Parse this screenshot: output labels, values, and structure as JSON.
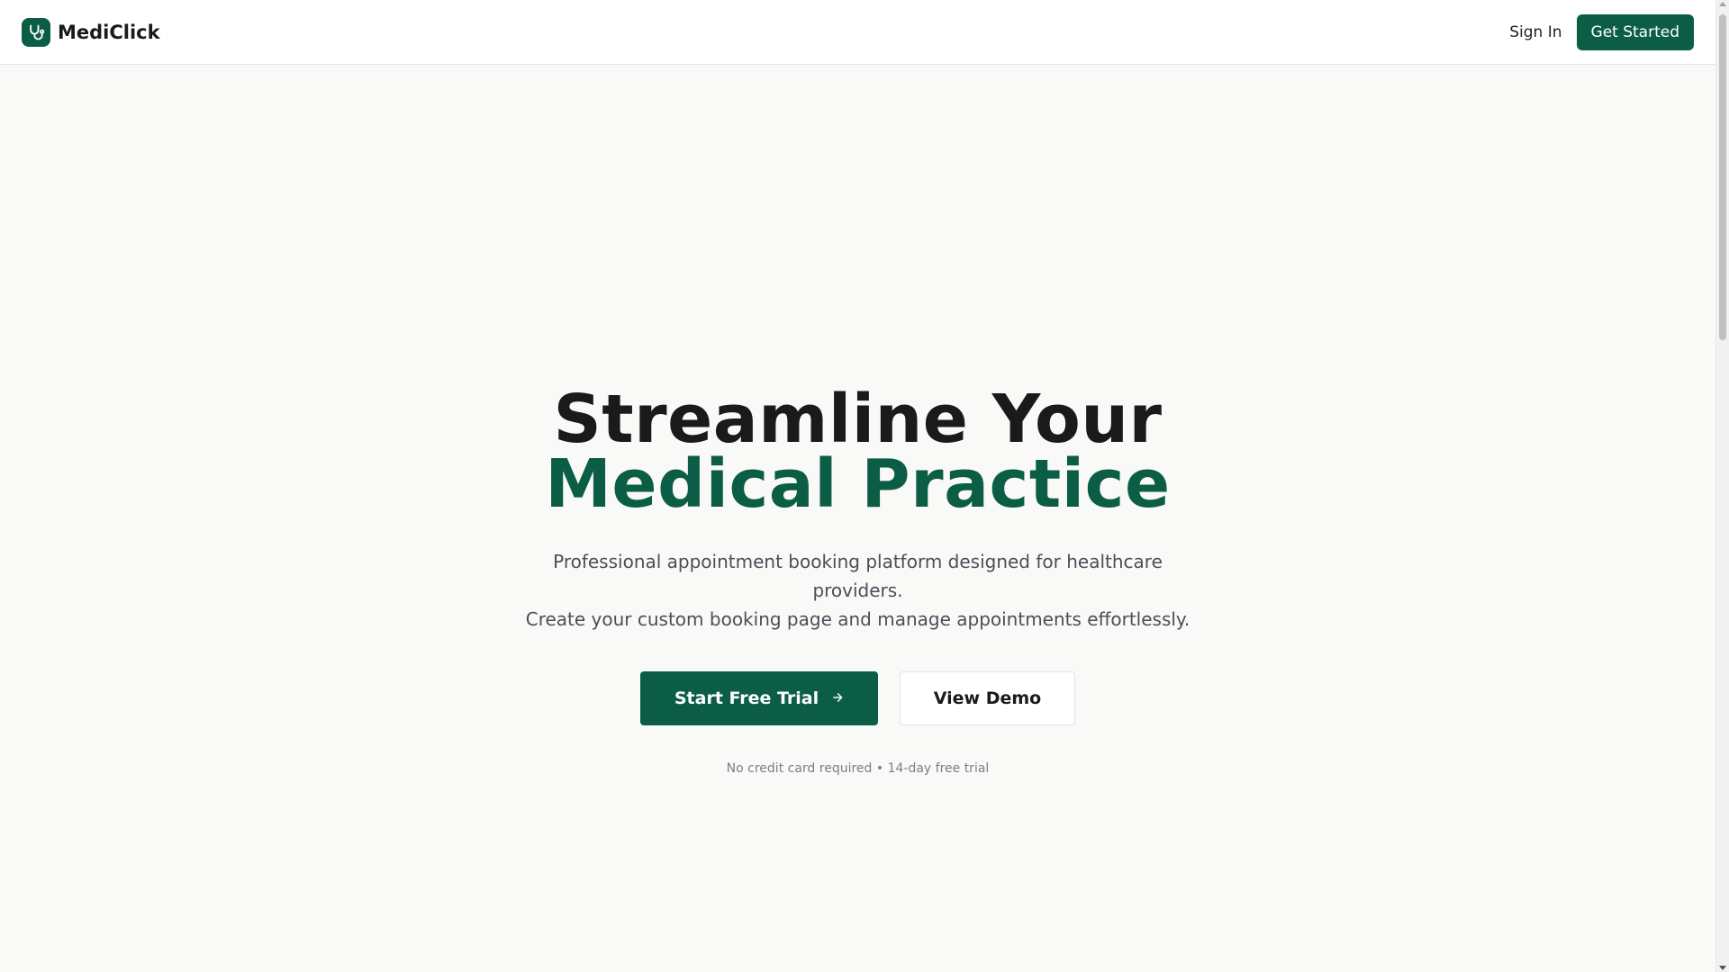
{
  "header": {
    "brand_name": "MediClick",
    "logo_icon": "stethoscope-icon",
    "sign_in_label": "Sign In",
    "get_started_label": "Get Started"
  },
  "hero": {
    "title_line1": "Streamline Your",
    "title_line2": "Medical Practice",
    "subtitle_line1": "Professional appointment booking platform designed for healthcare providers.",
    "subtitle_line2": "Create your custom booking page and manage appointments effortlessly.",
    "primary_cta_label": "Start Free Trial",
    "primary_cta_icon": "arrow-right-icon",
    "secondary_cta_label": "View Demo",
    "note": "No credit card required • 14-day free trial"
  },
  "colors": {
    "brand": "#0b5e45",
    "background": "#f9f9f8",
    "text": "#1a1a1a",
    "muted": "#4a4f57"
  }
}
